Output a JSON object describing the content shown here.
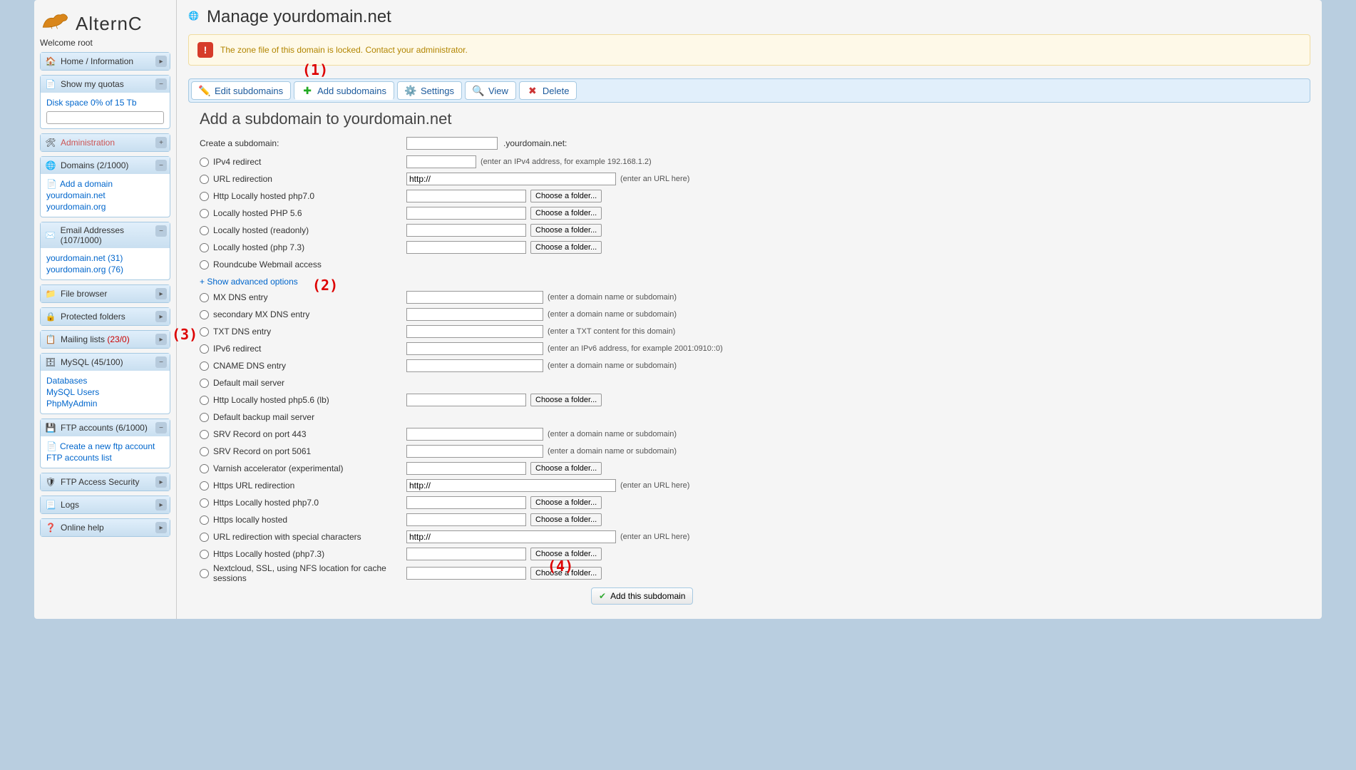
{
  "logo": {
    "text": "AlternC"
  },
  "welcome": "Welcome root",
  "sidebar": {
    "home": {
      "label": "Home / Information"
    },
    "quotas": {
      "label": "Show my quotas",
      "disk": "Disk space 0% of 15 Tb"
    },
    "admin": {
      "label": "Administration"
    },
    "domains": {
      "label": "Domains (2/1000)",
      "add": "Add a domain",
      "d1": "yourdomain.net",
      "d2": "yourdomain.org"
    },
    "emails": {
      "label": "Email Addresses (107/1000)",
      "e1": "yourdomain.net (31)",
      "e2": "yourdomain.org (76)"
    },
    "filebrowser": {
      "label": "File browser"
    },
    "protected": {
      "label": "Protected folders"
    },
    "mailing": {
      "label": "Mailing lists ",
      "count": "(23/0)"
    },
    "mysql": {
      "label": "MySQL (45/100)",
      "m1": "Databases",
      "m2": "MySQL Users",
      "m3": "PhpMyAdmin"
    },
    "ftp": {
      "label": "FTP accounts (6/1000)",
      "f1": "Create a new ftp account",
      "f2": "FTP accounts list"
    },
    "ftpsec": {
      "label": "FTP Access Security"
    },
    "logs": {
      "label": "Logs"
    },
    "help": {
      "label": "Online help"
    }
  },
  "page": {
    "title": "Manage yourdomain.net",
    "alert": "The zone file of this domain is locked. Contact your administrator.",
    "tabs": {
      "edit": "Edit subdomains",
      "add": "Add subdomains",
      "settings": "Settings",
      "view": "View",
      "delete": "Delete"
    },
    "section": "Add a subdomain to yourdomain.net",
    "create_label": "Create a subdomain:",
    "domain_suffix": ".yourdomain.net:",
    "advanced": "+ Show advanced options",
    "submit": "Add this subdomain",
    "choose": "Choose a folder...",
    "hints": {
      "ipv4": "(enter an IPv4 address, for example 192.168.1.2)",
      "url": "(enter an URL here)",
      "domain": "(enter a domain name or subdomain)",
      "txt": "(enter a TXT content for this domain)",
      "ipv6": "(enter an IPv6 address, for example 2001:0910::0)"
    },
    "http_default": "http://",
    "options": {
      "ipv4": "IPv4 redirect",
      "url": "URL redirection",
      "php70": "Http Locally hosted php7.0",
      "php56": "Locally hosted PHP 5.6",
      "ro": "Locally hosted (readonly)",
      "php73": "Locally hosted (php 7.3)",
      "roundcube": "Roundcube Webmail access",
      "mx": "MX DNS entry",
      "mx2": "secondary MX DNS entry",
      "txt": "TXT DNS entry",
      "ipv6": "IPv6 redirect",
      "cname": "CNAME DNS entry",
      "defmail": "Default mail server",
      "php56lb": "Http Locally hosted php5.6 (lb)",
      "defbackup": "Default backup mail server",
      "srv443": "SRV Record on port 443",
      "srv5061": "SRV Record on port 5061",
      "varnish": "Varnish accelerator (experimental)",
      "httpsurl": "Https URL redirection",
      "httpsphp70": "Https Locally hosted php7.0",
      "httpslocal": "Https locally hosted",
      "urlspec": "URL redirection with special characters",
      "httpsphp73": "Https Locally hosted (php7.3)",
      "nextcloud": "Nextcloud, SSL, using NFS location for cache sessions"
    }
  },
  "annot": {
    "a1": "(1)",
    "a2": "(2)",
    "a3": "(3)",
    "a4": "(4)"
  }
}
